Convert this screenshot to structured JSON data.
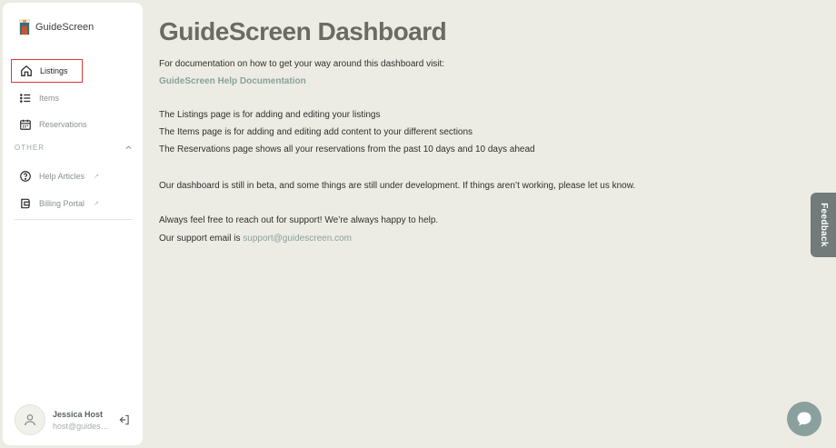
{
  "sidebar": {
    "brand": "GuideScreen",
    "nav": [
      {
        "label": "Listings",
        "icon": "home-icon",
        "active": true
      },
      {
        "label": "Items",
        "icon": "list-icon"
      },
      {
        "label": "Reservations",
        "icon": "calendar-icon"
      }
    ],
    "section_label": "OTHER",
    "other": [
      {
        "label": "Help Articles",
        "icon": "help-circle-icon",
        "ext": "↗"
      },
      {
        "label": "Billing Portal",
        "icon": "wallet-icon",
        "ext": "↗"
      }
    ],
    "user": {
      "name": "Jessica Host",
      "email": "host@guidescreen.com"
    }
  },
  "main": {
    "title": "GuideScreen Dashboard",
    "intro": "For documentation on how to get your way around this dashboard visit:",
    "doc_link": "GuideScreen Help Documentation",
    "lines": [
      "The Listings page is for adding and editing your listings",
      "The Items page is for adding and editing add content to your different sections",
      "The Reservations page shows all your reservations from the past 10 days and 10 days ahead"
    ],
    "beta_note": "Our dashboard is still in beta, and some things are still under development. If things aren’t working, please let us know.",
    "support_line": "Always feel free to reach out for support! We’re always happy to help.",
    "support_email_prefix": "Our support email is ",
    "support_email": "support@guidescreen.com"
  },
  "feedback": {
    "label": "Feedback"
  },
  "colors": {
    "accent": "#8aa09d",
    "active_border": "#d83a3a",
    "background": "#ecece4"
  }
}
